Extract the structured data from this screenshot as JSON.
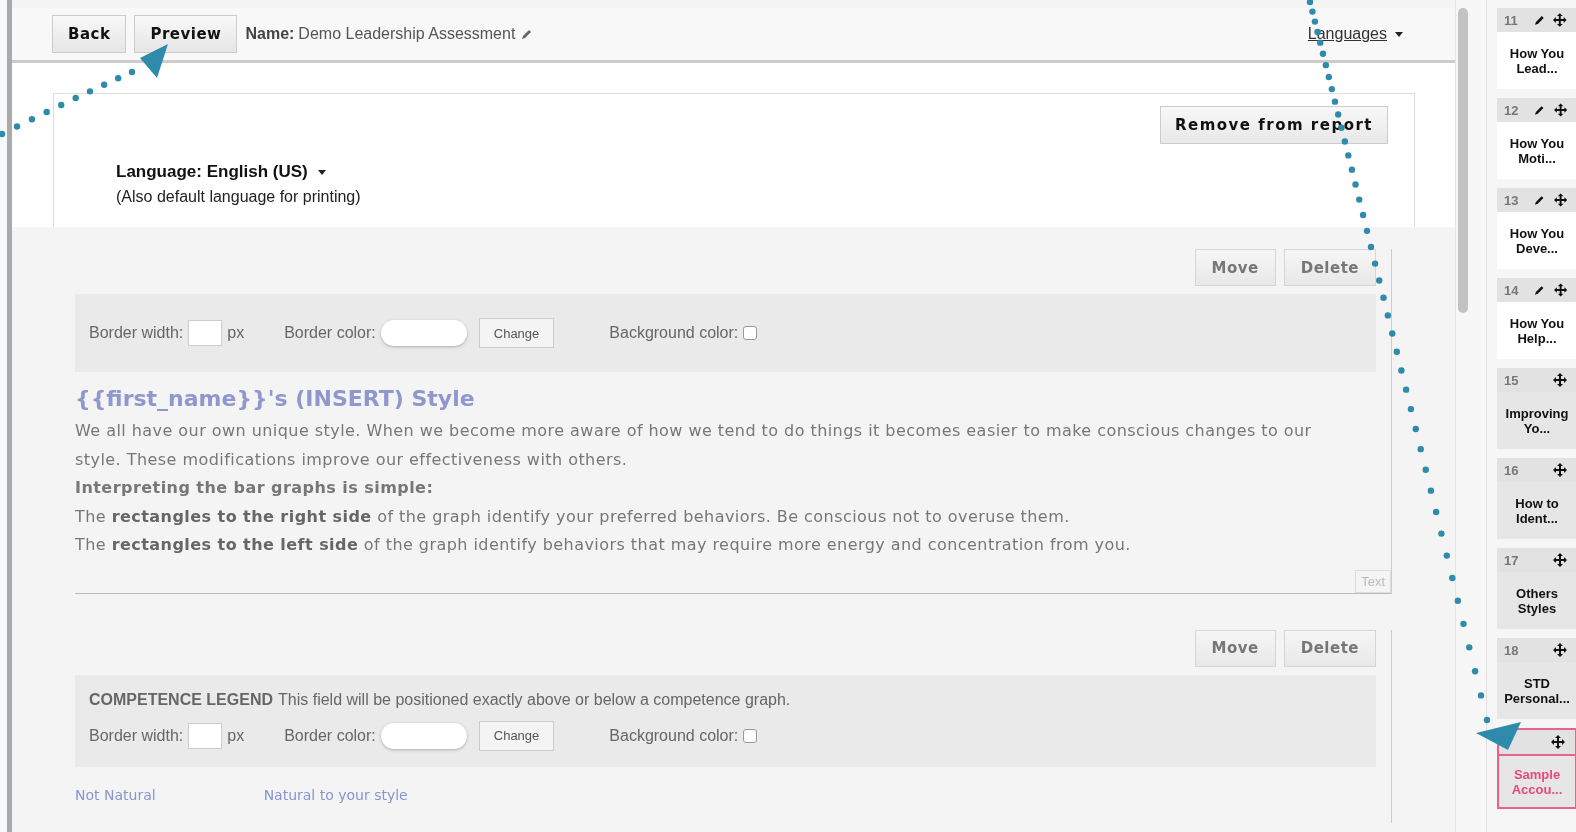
{
  "header": {
    "buttons": [
      {
        "label": "Back"
      },
      {
        "label": "Preview"
      }
    ],
    "name_label": "Name:",
    "name_value": "Demo Leadership Assessment",
    "languages_link": "Languages"
  },
  "language_panel": {
    "remove_button": "Remove from report",
    "language_label": "Language: English (US)",
    "note": "(Also default language for printing)"
  },
  "blocks": [
    {
      "kind": "text",
      "move": "Move",
      "delete": "Delete",
      "settings": {
        "border_width_label": "Border width:",
        "unit": "px",
        "border_color_label": "Border color:",
        "change": "Change",
        "background_label": "Background color:",
        "background_checked": false
      },
      "title": "{{first_name}}'s (INSERT) Style",
      "paragraphs": [
        {
          "text": "We all have our own unique style. When we become more aware of how we tend to do things it becomes easier to make conscious changes to our style. These modifications improve our effectiveness with others.",
          "emphasis": false
        },
        {
          "text": "Interpreting the bar graphs is simple:",
          "emphasis": true
        },
        {
          "text": "The **rectangles to the right side** of the graph identify your preferred behaviors. Be conscious not to overuse them.",
          "emphasis": false
        },
        {
          "text": "The **rectangles to the left side** of the graph identify behaviors that may require more energy and concentration from you.",
          "emphasis": false
        }
      ],
      "tag": "Text"
    },
    {
      "kind": "legend",
      "move": "Move",
      "delete": "Delete",
      "legend_title": "COMPETENCE LEGEND",
      "legend_desc": "This field will be positioned exactly above or below a competence graph.",
      "settings": {
        "border_width_label": "Border width:",
        "unit": "px",
        "border_color_label": "Border color:",
        "change": "Change",
        "background_label": "Background color:",
        "background_checked": false
      },
      "legend_labels": [
        "Not Natural",
        "Natural to your style"
      ]
    }
  ],
  "sidebar": {
    "items": [
      {
        "number": "11",
        "title": "How You Lead...",
        "editable": true,
        "selected": false
      },
      {
        "number": "12",
        "title": "How You Moti...",
        "editable": true,
        "selected": false
      },
      {
        "number": "13",
        "title": "How You Deve...",
        "editable": true,
        "selected": false
      },
      {
        "number": "14",
        "title": "How You Help...",
        "editable": true,
        "selected": false
      },
      {
        "number": "15",
        "title": "Improving Yo...",
        "editable": false,
        "selected": false
      },
      {
        "number": "16",
        "title": "How to Ident...",
        "editable": false,
        "selected": false
      },
      {
        "number": "17",
        "title": "Others Styles",
        "editable": false,
        "selected": false
      },
      {
        "number": "18",
        "title": "STD Personal...",
        "editable": false,
        "selected": false
      },
      {
        "title": "Sample Accou...",
        "editable": false,
        "selected": true
      }
    ]
  }
}
